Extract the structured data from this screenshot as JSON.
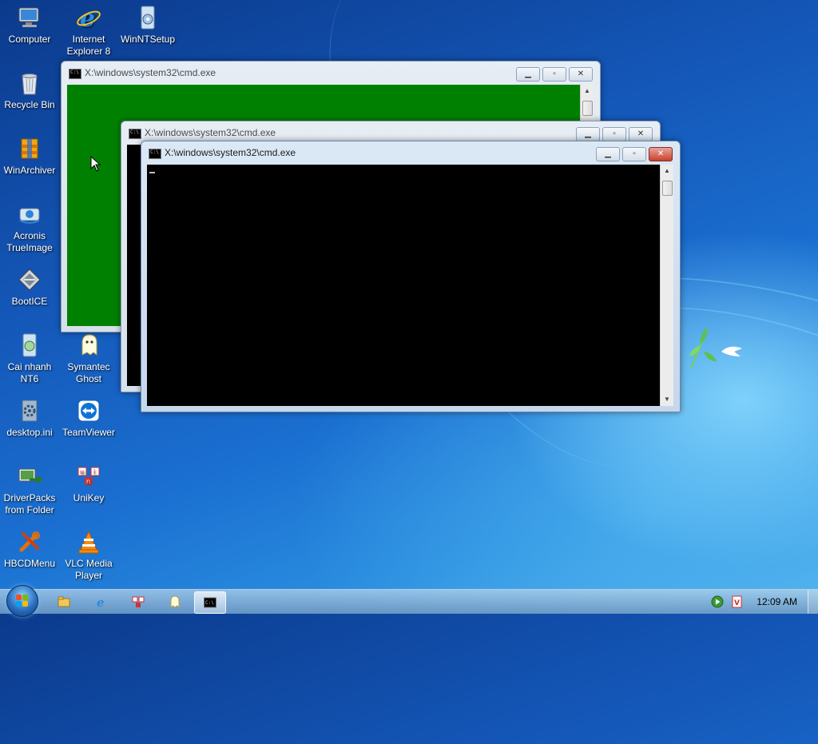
{
  "desktop": {
    "icons": [
      {
        "label": "Computer",
        "icon": "computer-icon"
      },
      {
        "label": "Internet\nExplorer 8",
        "icon": "internet-explorer-icon"
      },
      {
        "label": "WinNTSetup",
        "icon": "winntsetup-icon"
      },
      {
        "label": "Recycle Bin",
        "icon": "recycle-bin-icon"
      },
      {
        "label": "WinArchiver",
        "icon": "winarchiver-icon"
      },
      {
        "label": "Acronis\nTrueImage",
        "icon": "acronis-icon"
      },
      {
        "label": "BootICE",
        "icon": "bootice-icon"
      },
      {
        "label": "Cai nhanh\nNT6",
        "icon": "cai-nhanh-icon"
      },
      {
        "label": "Symantec\nGhost",
        "icon": "ghost-icon"
      },
      {
        "label": "desktop.ini",
        "icon": "settings-file-icon"
      },
      {
        "label": "TeamViewer",
        "icon": "teamviewer-icon"
      },
      {
        "label": "DriverPacks\nfrom Folder",
        "icon": "driverpacks-icon"
      },
      {
        "label": "UniKey",
        "icon": "unikey-icon"
      },
      {
        "label": "HBCDMenu",
        "icon": "hbcdmenu-icon"
      },
      {
        "label": "VLC Media\nPlayer",
        "icon": "vlc-icon"
      }
    ]
  },
  "windows": [
    {
      "title": "X:\\windows\\system32\\cmd.exe",
      "background": "#008000",
      "state": "inactive"
    },
    {
      "title": "X:\\windows\\system32\\cmd.exe",
      "background": "#000000",
      "state": "inactive"
    },
    {
      "title": "X:\\windows\\system32\\cmd.exe",
      "background": "#000000",
      "state": "active"
    }
  ],
  "window_controls": {
    "minimize": "▁",
    "maximize": "▫",
    "close": "✕"
  },
  "taskbar": {
    "start": "start-button",
    "pinned": [
      "explorer-icon",
      "internet-explorer-icon",
      "unikey-icon",
      "ghost-icon",
      "cmd-icon"
    ],
    "tray": [
      "media-play-icon",
      "unikey-tray-icon"
    ],
    "clock": "12:09 AM"
  }
}
